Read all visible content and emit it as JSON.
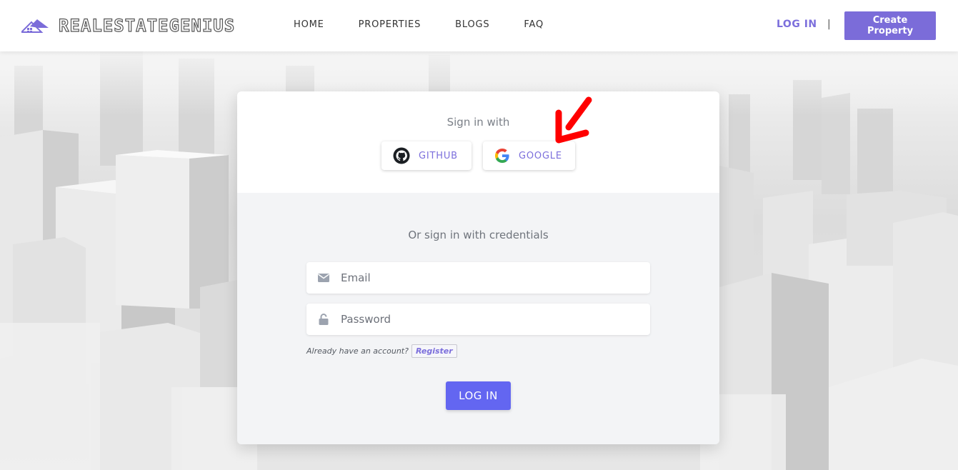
{
  "header": {
    "logo_text": "REALESTATEGENIUS",
    "nav": [
      {
        "label": "HOME"
      },
      {
        "label": "PROPERTIES"
      },
      {
        "label": "BLOGS"
      },
      {
        "label": "FAQ"
      }
    ],
    "login_label": "LOG IN",
    "separator": "|",
    "create_label": "Create Property"
  },
  "card": {
    "sign_in_with": "Sign in with",
    "github_label": "GITHUB",
    "google_label": "GOOGLE",
    "or_sign_in": "Or sign in with credentials",
    "email_placeholder": "Email",
    "password_placeholder": "Password",
    "account_text": "Already have an account?",
    "register_label": "Register",
    "login_button": "LOG IN"
  },
  "colors": {
    "accent": "#7b6cd9",
    "login_button": "#6366f1",
    "arrow": "#ff0000"
  }
}
